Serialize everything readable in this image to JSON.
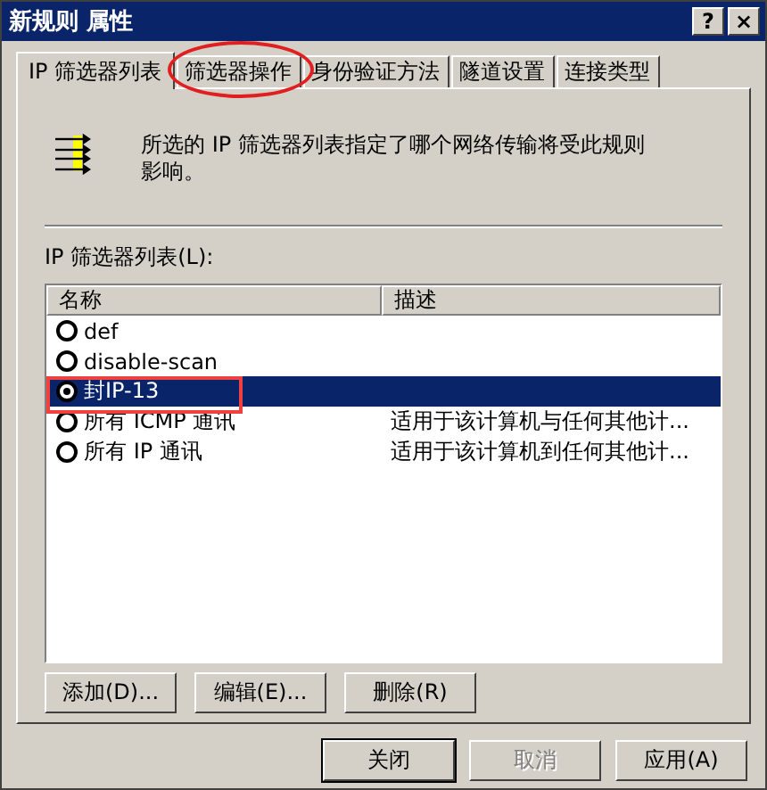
{
  "window": {
    "title": "新规则 属性",
    "help_button": "?",
    "close_button": "×"
  },
  "tabs": [
    {
      "label": "IP 筛选器列表",
      "selected": true
    },
    {
      "label": "筛选器操作",
      "selected": false
    },
    {
      "label": "身份验证方法",
      "selected": false
    },
    {
      "label": "隧道设置",
      "selected": false
    },
    {
      "label": "连接类型",
      "selected": false
    }
  ],
  "description": "所选的 IP 筛选器列表指定了哪个网络传输将受此规则影响。",
  "list_label": "IP 筛选器列表(L):",
  "table": {
    "columns": [
      "名称",
      "描述"
    ],
    "rows": [
      {
        "name": "def",
        "description": "",
        "checked": false,
        "selected": false
      },
      {
        "name": "disable-scan",
        "description": "",
        "checked": false,
        "selected": false
      },
      {
        "name": "封IP-13",
        "description": "",
        "checked": true,
        "selected": true
      },
      {
        "name": "所有 ICMP 通讯",
        "description": "适用于该计算机与任何其他计...",
        "checked": false,
        "selected": false
      },
      {
        "name": "所有 IP 通讯",
        "description": "适用于该计算机到任何其他计...",
        "checked": false,
        "selected": false
      }
    ]
  },
  "list_buttons": [
    {
      "label": "添加(D)...",
      "disabled": false
    },
    {
      "label": "编辑(E)...",
      "disabled": false
    },
    {
      "label": "删除(R)",
      "disabled": false
    }
  ],
  "dialog_buttons": [
    {
      "label": "关闭",
      "disabled": false,
      "default": true
    },
    {
      "label": "取消",
      "disabled": true,
      "default": false
    },
    {
      "label": "应用(A)",
      "disabled": false,
      "default": false
    }
  ]
}
